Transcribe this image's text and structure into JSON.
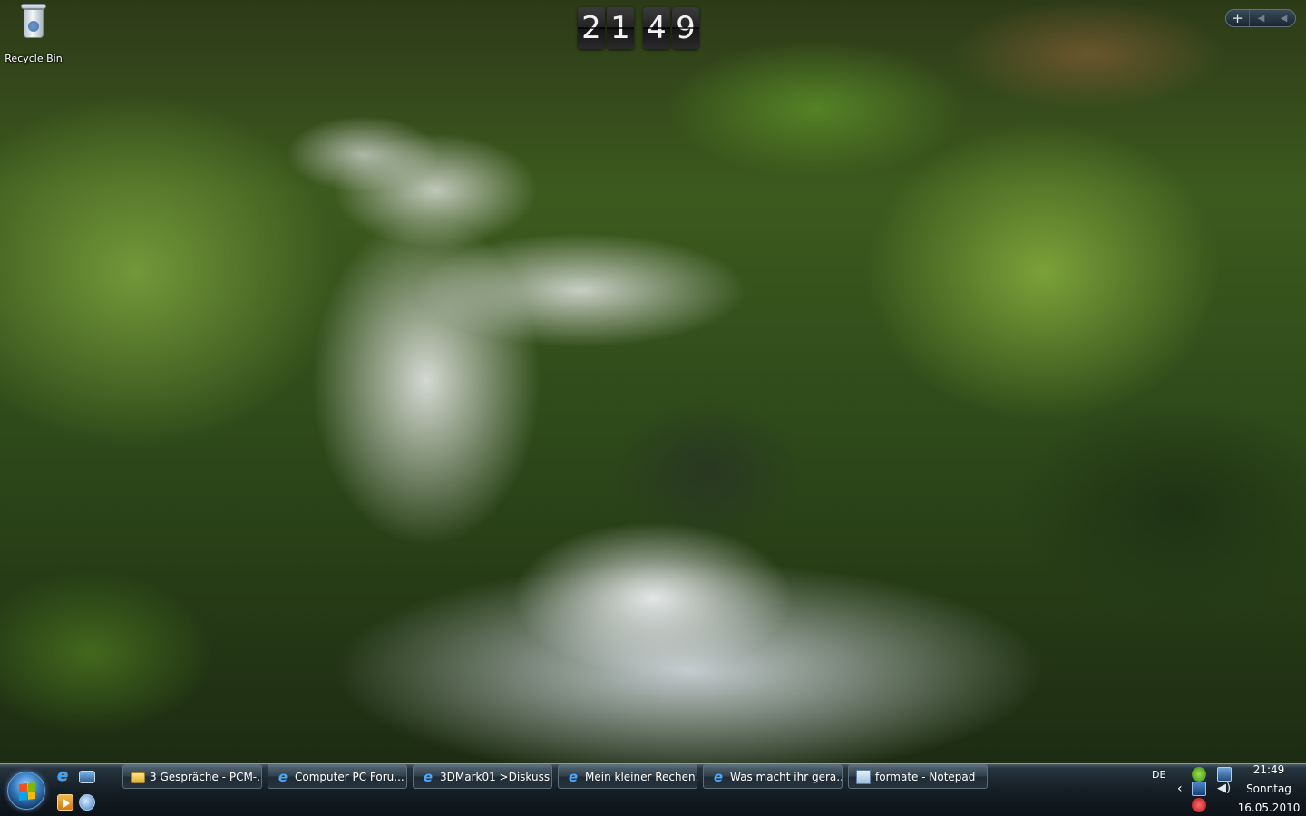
{
  "desktop": {
    "icons": [
      {
        "label": "Recycle Bin",
        "icon": "recycle-bin-icon"
      }
    ]
  },
  "clock_gadget": {
    "digits": [
      "2",
      "1",
      "4",
      "9"
    ]
  },
  "sidebar_control": {
    "add_label": "+",
    "prev_label": "◀",
    "next_label": "◀"
  },
  "taskbar": {
    "quick_launch": [
      {
        "icon": "internet-explorer-icon"
      },
      {
        "icon": "show-desktop-icon"
      },
      {
        "icon": "media-player-icon"
      },
      {
        "icon": "switch-windows-icon"
      }
    ],
    "tasks": [
      {
        "label": "3 Gespräche - PCM-...",
        "icon": "folder-chat-icon"
      },
      {
        "label": "Computer PC Foru...",
        "icon": "internet-explorer-icon"
      },
      {
        "label": "3DMark01 >Diskussi...",
        "icon": "internet-explorer-icon"
      },
      {
        "label": "Mein kleiner Rechen...",
        "icon": "internet-explorer-icon"
      },
      {
        "label": "Was macht ihr gera...",
        "icon": "internet-explorer-icon"
      },
      {
        "label": "formate - Notepad",
        "icon": "notepad-icon"
      }
    ],
    "tray": {
      "language": "DE",
      "time": "21:49",
      "day": "Sonntag",
      "date": "16.05.2010"
    }
  }
}
